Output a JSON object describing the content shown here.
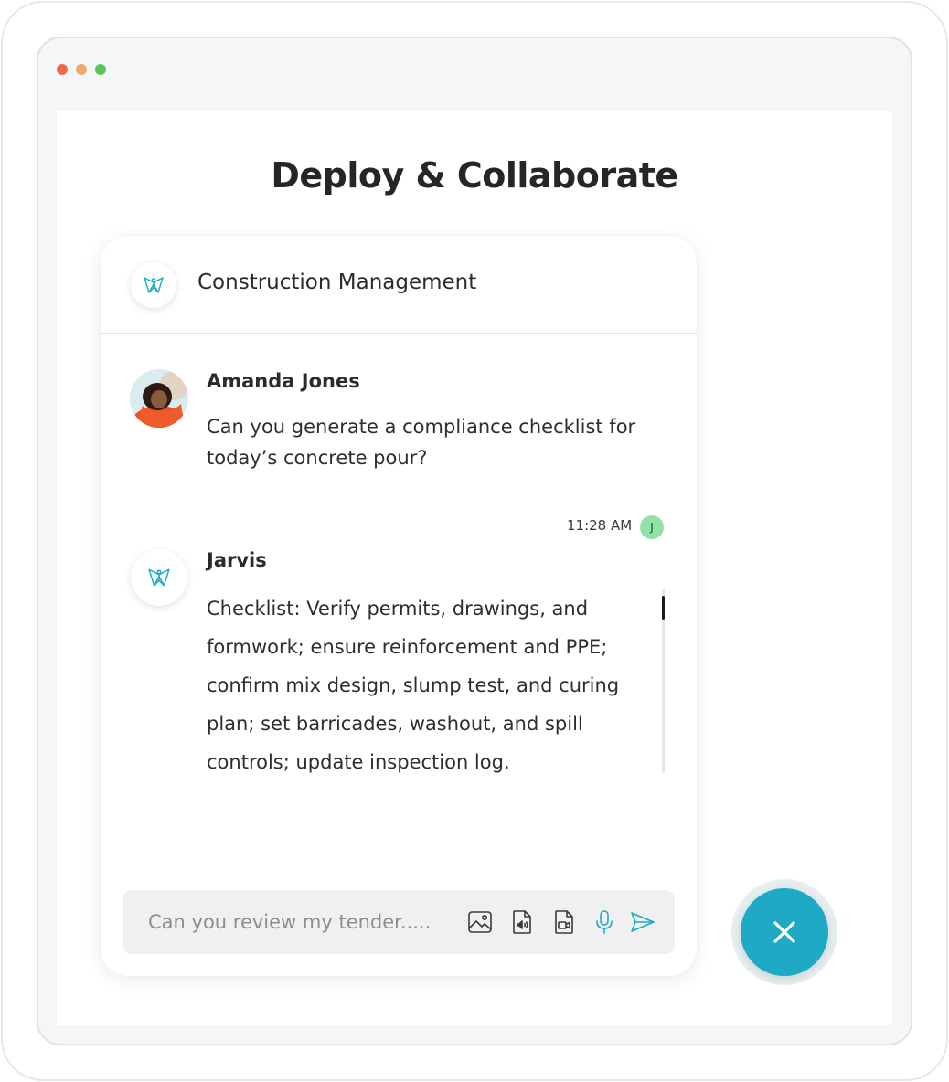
{
  "page": {
    "title": "Deploy & Collaborate"
  },
  "chat": {
    "header_title": "Construction Management",
    "messages": [
      {
        "sender": "Amanda Jones",
        "text": "Can you generate a compliance checklist for today’s concrete pour?"
      },
      {
        "time": "11:28 AM",
        "reader_initial": "J",
        "sender": "Jarvis",
        "text": "Checklist: Verify permits, drawings, and formwork; ensure reinforcement and PPE; confirm mix design, slump test, and curing plan; set barricades, washout, and spill controls; update inspection log."
      }
    ],
    "input": {
      "placeholder": "Can you review my tender.....",
      "value": ""
    },
    "tools": [
      "image-icon",
      "audio-file-icon",
      "video-file-icon",
      "mic-icon",
      "send-icon"
    ]
  },
  "colors": {
    "accent": "#1eaac4",
    "window_dot_red": "#ec6a4a",
    "window_dot_yellow": "#efaa6a",
    "window_dot_green": "#5cc45b",
    "reader_badge": "#8fe3a6"
  }
}
